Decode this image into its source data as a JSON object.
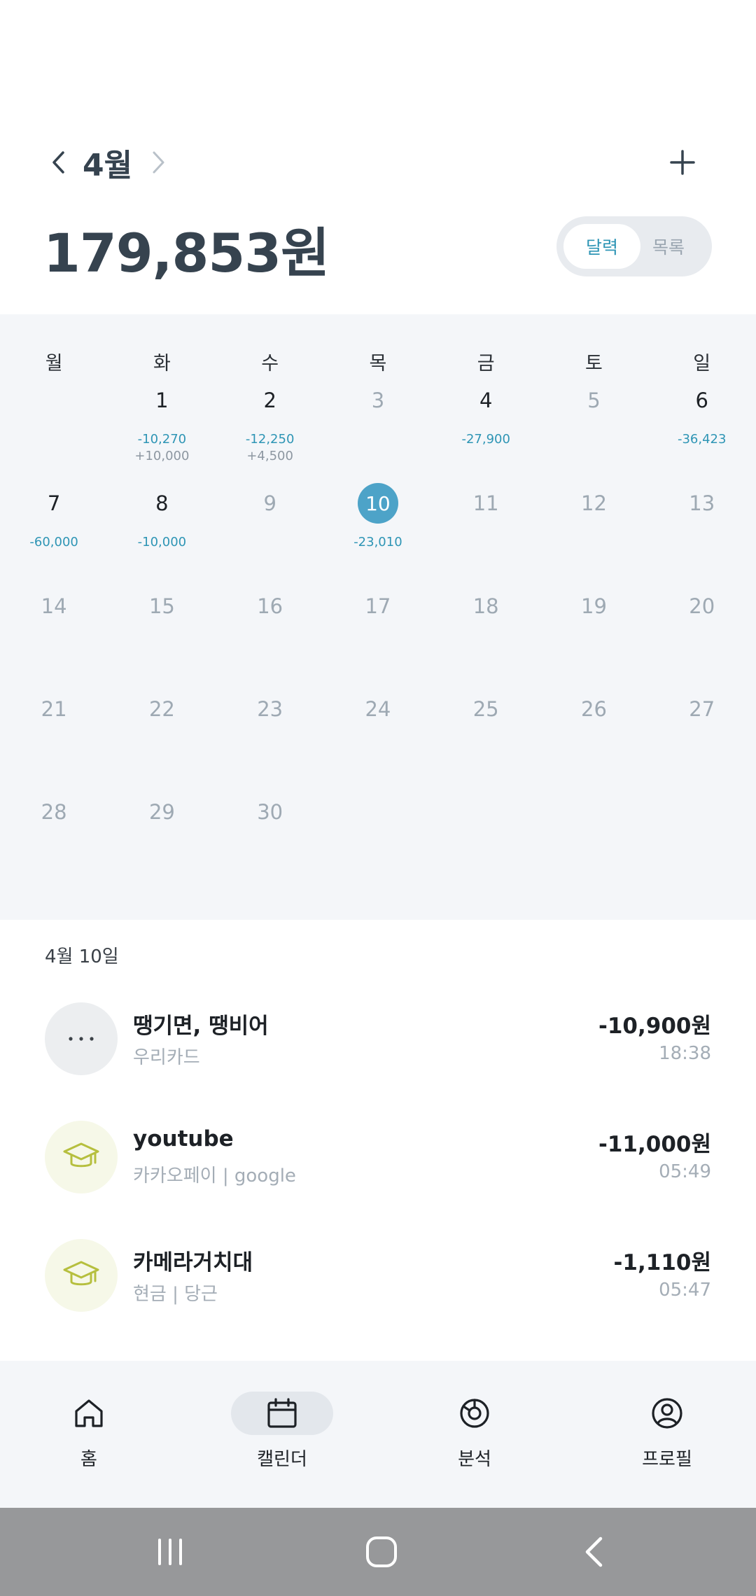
{
  "header": {
    "month": "4월",
    "total": "179,853원",
    "view_toggle": {
      "calendar": "달력",
      "list": "목록",
      "selected": "달력"
    }
  },
  "calendar": {
    "weekdays": [
      "월",
      "화",
      "수",
      "목",
      "금",
      "토",
      "일"
    ],
    "weeks": [
      [
        {
          "day": "",
          "expense": "",
          "income": "",
          "has": false
        },
        {
          "day": "1",
          "expense": "-10,270",
          "income": "+10,000",
          "has": true
        },
        {
          "day": "2",
          "expense": "-12,250",
          "income": "+4,500",
          "has": true
        },
        {
          "day": "3",
          "expense": "",
          "income": "",
          "has": false
        },
        {
          "day": "4",
          "expense": "-27,900",
          "income": "",
          "has": true
        },
        {
          "day": "5",
          "expense": "",
          "income": "",
          "has": false
        },
        {
          "day": "6",
          "expense": "-36,423",
          "income": "",
          "has": true
        }
      ],
      [
        {
          "day": "7",
          "expense": "-60,000",
          "income": "",
          "has": true
        },
        {
          "day": "8",
          "expense": "-10,000",
          "income": "",
          "has": true
        },
        {
          "day": "9",
          "expense": "",
          "income": "",
          "has": false
        },
        {
          "day": "10",
          "expense": "-23,010",
          "income": "",
          "has": true,
          "today": true
        },
        {
          "day": "11",
          "expense": "",
          "income": "",
          "has": false
        },
        {
          "day": "12",
          "expense": "",
          "income": "",
          "has": false
        },
        {
          "day": "13",
          "expense": "",
          "income": "",
          "has": false
        }
      ],
      [
        {
          "day": "14",
          "expense": "",
          "income": "",
          "has": false
        },
        {
          "day": "15",
          "expense": "",
          "income": "",
          "has": false
        },
        {
          "day": "16",
          "expense": "",
          "income": "",
          "has": false
        },
        {
          "day": "17",
          "expense": "",
          "income": "",
          "has": false
        },
        {
          "day": "18",
          "expense": "",
          "income": "",
          "has": false
        },
        {
          "day": "19",
          "expense": "",
          "income": "",
          "has": false
        },
        {
          "day": "20",
          "expense": "",
          "income": "",
          "has": false
        }
      ],
      [
        {
          "day": "21",
          "expense": "",
          "income": "",
          "has": false
        },
        {
          "day": "22",
          "expense": "",
          "income": "",
          "has": false
        },
        {
          "day": "23",
          "expense": "",
          "income": "",
          "has": false
        },
        {
          "day": "24",
          "expense": "",
          "income": "",
          "has": false
        },
        {
          "day": "25",
          "expense": "",
          "income": "",
          "has": false
        },
        {
          "day": "26",
          "expense": "",
          "income": "",
          "has": false
        },
        {
          "day": "27",
          "expense": "",
          "income": "",
          "has": false
        }
      ],
      [
        {
          "day": "28",
          "expense": "",
          "income": "",
          "has": false
        },
        {
          "day": "29",
          "expense": "",
          "income": "",
          "has": false
        },
        {
          "day": "30",
          "expense": "",
          "income": "",
          "has": false
        },
        {
          "day": "",
          "expense": "",
          "income": "",
          "has": false
        },
        {
          "day": "",
          "expense": "",
          "income": "",
          "has": false
        },
        {
          "day": "",
          "expense": "",
          "income": "",
          "has": false
        },
        {
          "day": "",
          "expense": "",
          "income": "",
          "has": false
        }
      ]
    ]
  },
  "transactions": {
    "date": "4월 10일",
    "items": [
      {
        "name": "땡기면, 땡비어",
        "sub": "우리카드",
        "amount": "-10,900원",
        "time": "18:38",
        "icon": "more-dots-icon"
      },
      {
        "name": "youtube",
        "sub": "카카오페이 | google",
        "amount": "-11,000원",
        "time": "05:49",
        "icon": "graduation-cap-icon"
      },
      {
        "name": "카메라거치대",
        "sub": "현금 | 당근",
        "amount": "-1,110원",
        "time": "05:47",
        "icon": "graduation-cap-icon"
      }
    ]
  },
  "bottom_nav": {
    "items": [
      {
        "label": "홈",
        "icon": "home-icon"
      },
      {
        "label": "캘린더",
        "icon": "calendar-icon",
        "active": true
      },
      {
        "label": "분석",
        "icon": "pie-chart-icon"
      },
      {
        "label": "프로필",
        "icon": "profile-icon"
      }
    ]
  },
  "colors": {
    "accent": "#4da3c8",
    "expense_text": "#2e95b5",
    "heading": "#36434f",
    "calendar_bg": "#f4f6f9",
    "olive_icon": "#b6bf3e"
  }
}
